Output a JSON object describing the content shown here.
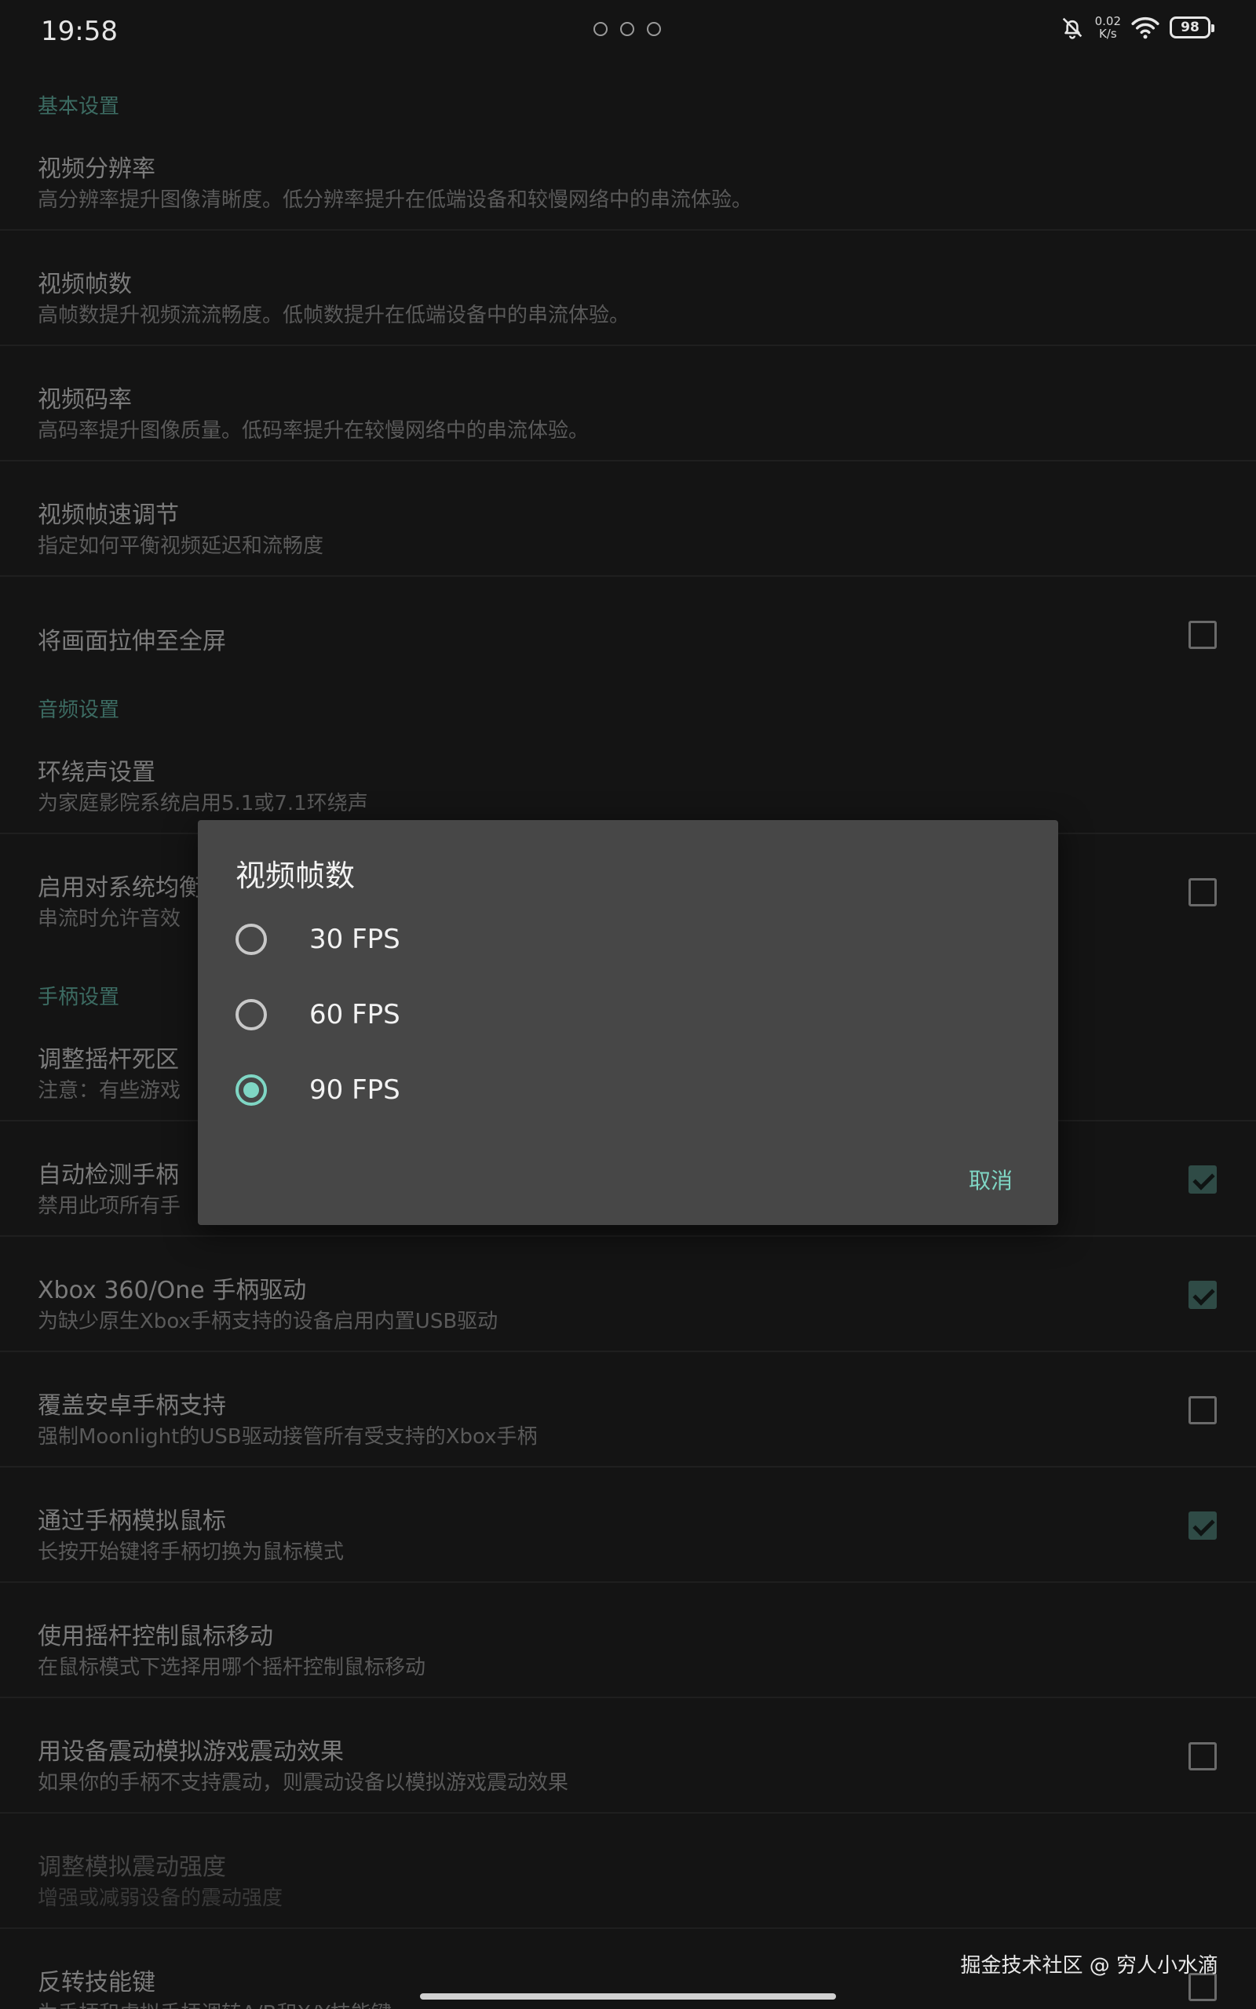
{
  "status_bar": {
    "time": "19:58",
    "speed_value": "0.02",
    "speed_unit": "K/s",
    "battery": "98",
    "icons": [
      "bell-off-icon",
      "wifi-icon",
      "battery-icon"
    ]
  },
  "sections": {
    "basic": "基本设置",
    "audio": "音频设置",
    "gamepad": "手柄设置"
  },
  "prefs": [
    {
      "title": "视频分辨率",
      "summary": "高分辨率提升图像清晰度。低分辨率提升在低端设备和较慢网络中的串流体验。"
    },
    {
      "title": "视频帧数",
      "summary": "高帧数提升视频流流畅度。低帧数提升在低端设备中的串流体验。"
    },
    {
      "title": "视频码率",
      "summary": "高码率提升图像质量。低码率提升在较慢网络中的串流体验。"
    },
    {
      "title": "视频帧速调节",
      "summary": "指定如何平衡视频延迟和流畅度"
    },
    {
      "title": "将画面拉伸至全屏",
      "checked": false
    },
    {
      "title": "环绕声设置",
      "summary": "为家庭影院系统启用5.1或7.1环绕声"
    },
    {
      "title": "启用对系统均衡",
      "summary": "串流时允许音效",
      "checked": false
    },
    {
      "title": "调整摇杆死区",
      "summary": "注意：有些游戏"
    },
    {
      "title": "自动检测手柄",
      "summary": "禁用此项所有手",
      "checked": true
    },
    {
      "title": "Xbox 360/One 手柄驱动",
      "summary": "为缺少原生Xbox手柄支持的设备启用内置USB驱动",
      "checked": true
    },
    {
      "title": "覆盖安卓手柄支持",
      "summary": "强制Moonlight的USB驱动接管所有受支持的Xbox手柄",
      "checked": false
    },
    {
      "title": "通过手柄模拟鼠标",
      "summary": "长按开始键将手柄切换为鼠标模式",
      "checked": true
    },
    {
      "title": "使用摇杆控制鼠标移动",
      "summary": "在鼠标模式下选择用哪个摇杆控制鼠标移动"
    },
    {
      "title": "用设备震动模拟游戏震动效果",
      "summary": "如果你的手柄不支持震动，则震动设备以模拟游戏震动效果",
      "checked": false
    },
    {
      "title": "调整模拟震动强度",
      "summary": "增强或减弱设备的震动强度",
      "disabled": true
    },
    {
      "title": "反转技能键",
      "summary": "为手柄和虚拟手柄调转A/B和X/Y技能键",
      "checked": false
    }
  ],
  "dialog": {
    "title": "视频帧数",
    "options": [
      "30 FPS",
      "60 FPS",
      "90 FPS"
    ],
    "selected": "90 FPS",
    "cancel": "取消"
  },
  "watermark": "掘金技术社区 @ 穷人小水滴",
  "colors": {
    "accent": "#7fd6c4",
    "section_header": "#3c6b62",
    "dialog_bg": "#474747",
    "background": "#141414"
  }
}
